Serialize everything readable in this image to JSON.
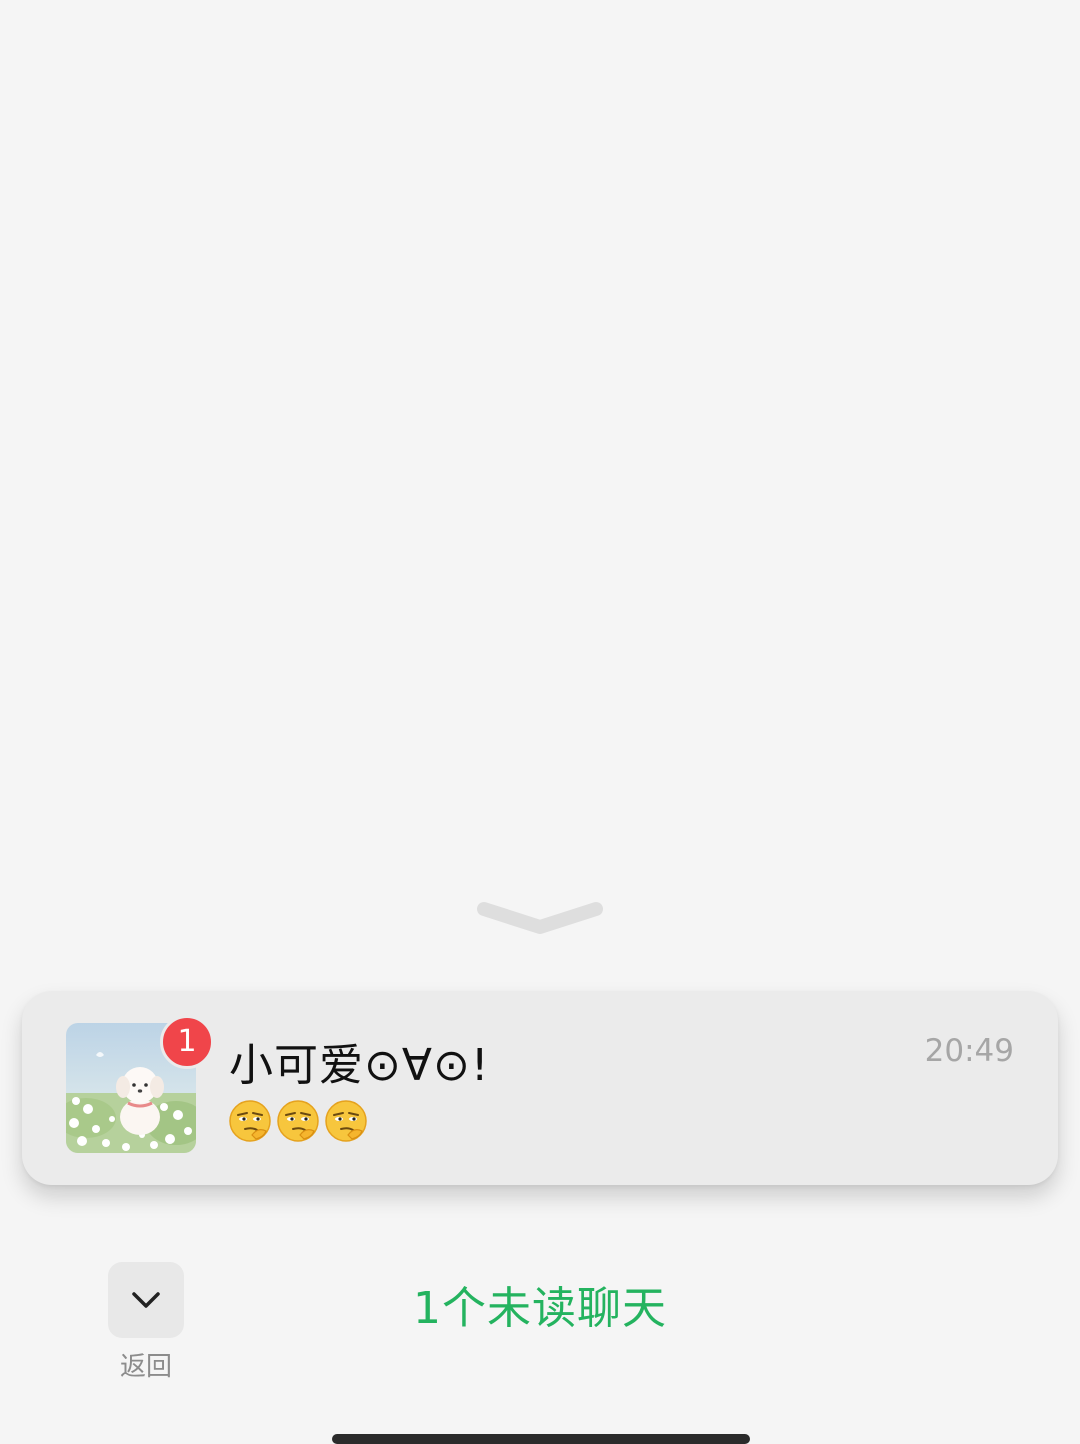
{
  "pull_handle": {
    "icon": "chevron-down-handle-icon"
  },
  "chat": {
    "name": "小可爱⊙∀⊙!",
    "time": "20:49",
    "unread_count": "1",
    "avatar_icon": "avatar-puppy-in-flowers",
    "preview_emojis": [
      "smirk-emoji",
      "smirk-emoji",
      "smirk-emoji"
    ]
  },
  "footer": {
    "back_label": "返回",
    "back_icon": "chevron-down-icon",
    "unread_summary": "1个未读聊天"
  },
  "colors": {
    "background": "#f5f5f5",
    "card": "#ebebeb",
    "badge": "#f0454a",
    "accent_green": "#24b35f"
  }
}
